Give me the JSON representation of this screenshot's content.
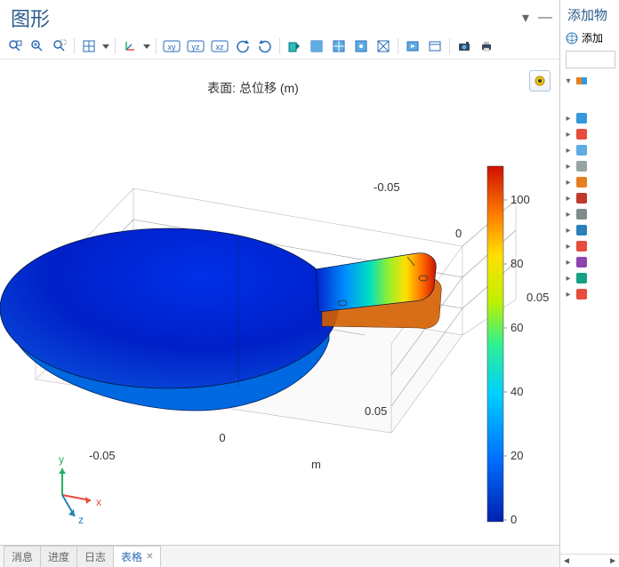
{
  "main": {
    "title": "图形",
    "plot_title": "表面: 总位移 (m)",
    "axis_label": "m",
    "axis_y_label": "y",
    "axis_x_label": "x",
    "axis_z_label": "z",
    "ticks_x": [
      "-0.05",
      "0",
      "0.05"
    ],
    "ticks_z": [
      "-0.05",
      "0",
      "0.05"
    ],
    "colorbar_ticks": [
      "0",
      "20",
      "40",
      "60",
      "80",
      "100"
    ]
  },
  "toolbar": {
    "items": [
      {
        "name": "zoom-to-fit-icon",
        "kind": "zoom-extents"
      },
      {
        "name": "zoom-in-icon",
        "kind": "zoom-in"
      },
      {
        "name": "zoom-out-icon",
        "kind": "zoom-box"
      },
      {
        "name": "sep"
      },
      {
        "name": "grid-icon",
        "kind": "grid"
      },
      {
        "name": "grid-dropdown-icon",
        "kind": "dropdown"
      },
      {
        "name": "sep"
      },
      {
        "name": "axis-triad-icon",
        "kind": "triad"
      },
      {
        "name": "axis-dropdown-icon",
        "kind": "dropdown"
      },
      {
        "name": "sep"
      },
      {
        "name": "view-xy-icon",
        "kind": "plane",
        "label": "xy"
      },
      {
        "name": "view-yz-icon",
        "kind": "plane",
        "label": "yz"
      },
      {
        "name": "view-xz-icon",
        "kind": "plane",
        "label": "xz"
      },
      {
        "name": "rotate-ccw-icon",
        "kind": "rotate-ccw"
      },
      {
        "name": "rotate-cw-icon",
        "kind": "rotate-cw"
      },
      {
        "name": "sep"
      },
      {
        "name": "light-icon",
        "kind": "light"
      },
      {
        "name": "transparency-icon",
        "kind": "transp"
      },
      {
        "name": "wireframe-icon",
        "kind": "wire"
      },
      {
        "name": "select-icon",
        "kind": "select"
      },
      {
        "name": "mesh-icon",
        "kind": "mesh"
      },
      {
        "name": "sep"
      },
      {
        "name": "render-icon",
        "kind": "render"
      },
      {
        "name": "window-icon",
        "kind": "window"
      },
      {
        "name": "sep"
      },
      {
        "name": "camera-icon",
        "kind": "camera"
      },
      {
        "name": "print-icon",
        "kind": "print"
      }
    ]
  },
  "corner_button": {
    "name": "plot-settings-icon"
  },
  "tabs": {
    "items": [
      {
        "label": "消息",
        "active": false,
        "closable": false
      },
      {
        "label": "进度",
        "active": false,
        "closable": false
      },
      {
        "label": "日志",
        "active": false,
        "closable": false
      },
      {
        "label": "表格",
        "active": true,
        "closable": true
      }
    ]
  },
  "side": {
    "title": "添加物",
    "add_label": "添加",
    "tree": [
      {
        "name": "tree-root-icon",
        "color1": "#e67e22",
        "color2": "#3498db"
      }
    ],
    "items": [
      {
        "name": "physics-icon-1",
        "color": "#3498db"
      },
      {
        "name": "physics-icon-2",
        "color": "#e74c3c"
      },
      {
        "name": "physics-icon-3",
        "color": "#5dade2"
      },
      {
        "name": "physics-icon-4",
        "color": "#95a5a6"
      },
      {
        "name": "physics-icon-5",
        "color": "#e67e22"
      },
      {
        "name": "physics-icon-6",
        "color": "#c0392b"
      },
      {
        "name": "physics-icon-7",
        "color": "#7f8c8d"
      },
      {
        "name": "physics-icon-8",
        "color": "#2980b9"
      },
      {
        "name": "physics-icon-9",
        "color": "#e74c3c"
      },
      {
        "name": "physics-icon-10",
        "color": "#8e44ad"
      },
      {
        "name": "physics-icon-11",
        "color": "#16a085"
      },
      {
        "name": "physics-icon-12",
        "color": "#e74c3c"
      }
    ]
  },
  "chart_data": {
    "type": "surface-3d",
    "title": "表面: 总位移 (m)",
    "axes": {
      "x": {
        "label": "m",
        "range": [
          -0.08,
          0.1
        ],
        "ticks": [
          -0.05,
          0,
          0.05
        ]
      },
      "z": {
        "label": "",
        "range": [
          -0.08,
          0.06
        ],
        "ticks": [
          -0.05,
          0,
          0.05
        ]
      },
      "y": {
        "label": "",
        "range": [
          0,
          0.02
        ]
      }
    },
    "colorbar": {
      "label": "",
      "range": [
        0,
        110
      ],
      "ticks": [
        0,
        20,
        40,
        60,
        80,
        100
      ],
      "colormap": "rainbow"
    },
    "description": "Table-tennis paddle shaped solid; displacement near 0 on circular blade, rising through handle to max (~110) at handle tip."
  }
}
